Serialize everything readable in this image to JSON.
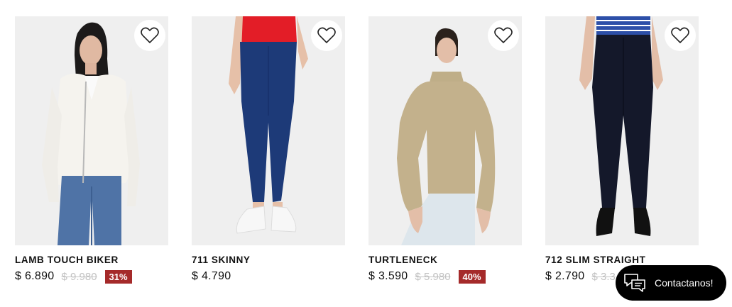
{
  "products": [
    {
      "name": "LAMB TOUCH BIKER",
      "price": "$ 6.890",
      "old_price": "$ 9.980",
      "discount": "31%",
      "image": "woman in white biker jacket and jeans"
    },
    {
      "name": "711 SKINNY",
      "price": "$ 4.790",
      "image": "dark blue skinny jeans with white sneakers"
    },
    {
      "name": "TURTLENECK",
      "price": "$ 3.590",
      "old_price": "$ 5.980",
      "discount": "40%",
      "image": "woman in beige turtleneck sweater"
    },
    {
      "name": "712 SLIM STRAIGHT",
      "price": "$ 2.790",
      "old_price": "$ 3.3",
      "image": "black slim straight jeans with black boots"
    }
  ],
  "chat": {
    "label": "Contactanos!",
    "icon": "chat-bubbles-icon"
  },
  "favorite_icon": "heart-outline-icon",
  "colors": {
    "discount_badge": "#a52a2a",
    "old_price": "#c2c2c2",
    "chat_bg": "#000000"
  }
}
